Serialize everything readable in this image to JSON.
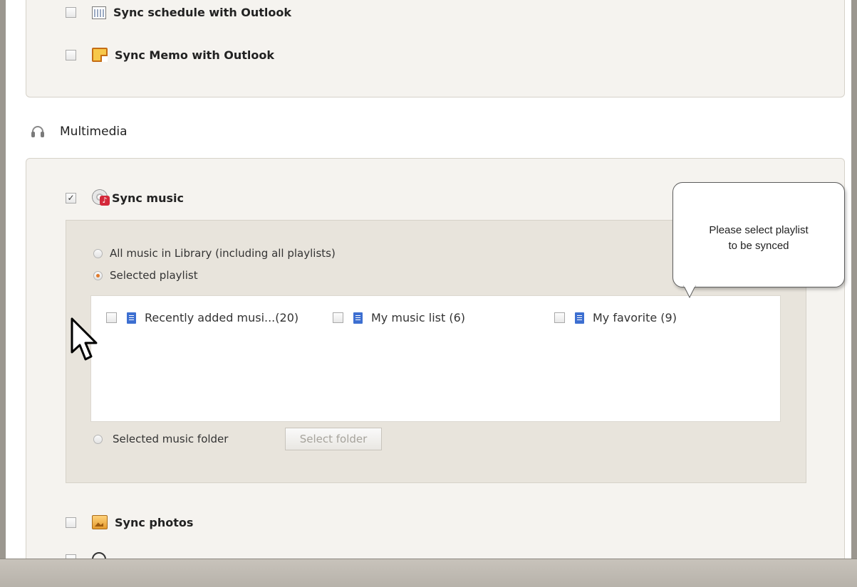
{
  "sync_items": {
    "schedule_label": "Sync schedule with Outlook",
    "memo_label": "Sync Memo with Outlook"
  },
  "multimedia": {
    "section_title": "Multimedia",
    "sync_music": {
      "label": "Sync music",
      "checked": true,
      "options": {
        "all_music": "All music in Library (including all playlists)",
        "selected_playlist": "Selected playlist",
        "selected_folder": "Selected music folder"
      },
      "selected_option": "selected_playlist",
      "select_folder_button": "Select folder",
      "playlists": [
        {
          "name": "Recently added musi...(20)",
          "checked": false
        },
        {
          "name": "My music list (6)",
          "checked": false
        },
        {
          "name": "My favorite (9)",
          "checked": false
        }
      ]
    },
    "sync_photos": {
      "label": "Sync photos",
      "checked": false
    }
  },
  "tooltip": {
    "line1": "Please select playlist",
    "line2": "to be synced"
  },
  "colors": {
    "panel_bg": "#f5f3ef",
    "inner_bg": "#e8e4dc",
    "radio_accent": "#e07b2c",
    "playlist_icon": "#3d6fd1"
  }
}
